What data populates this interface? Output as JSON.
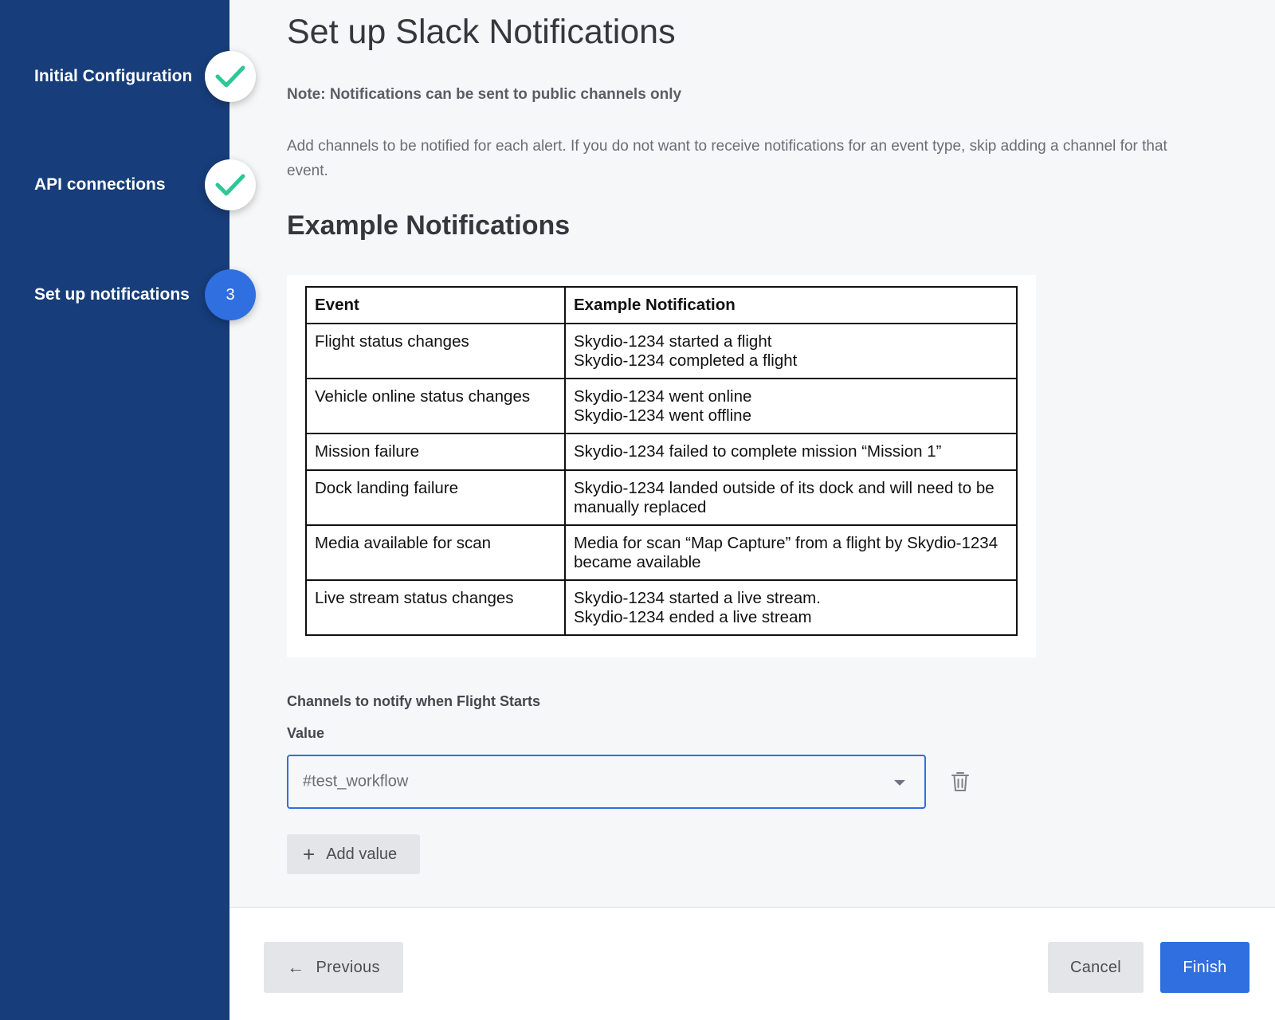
{
  "steps": [
    {
      "label": "Initial Configuration",
      "status": "done",
      "icon": "check-icon"
    },
    {
      "label": "API connections",
      "status": "done",
      "icon": "check-icon"
    },
    {
      "label": "Set up notifications",
      "status": "active",
      "number": "3"
    }
  ],
  "page": {
    "title": "Set up Slack Notifications",
    "note": "Note: Notifications can be sent to public channels only",
    "description": "Add channels to be notified for each alert. If you do not want to receive notifications for an event type, skip adding a channel for that event.",
    "section_title": "Example Notifications"
  },
  "examples_table": {
    "headers": [
      "Event",
      "Example Notification"
    ],
    "rows": [
      {
        "event": "Flight status changes",
        "lines": [
          "Skydio-1234 started a flight",
          "Skydio-1234 completed a flight"
        ]
      },
      {
        "event": "Vehicle online status changes",
        "lines": [
          "Skydio-1234 went online",
          "Skydio-1234 went offline"
        ]
      },
      {
        "event": "Mission failure",
        "lines": [
          "Skydio-1234 failed to complete mission “Mission 1”"
        ]
      },
      {
        "event": "Dock landing failure",
        "lines": [
          "Skydio-1234 landed outside of its dock and will need to be manually replaced"
        ]
      },
      {
        "event": "Media available for scan",
        "lines": [
          "Media for scan “Map Capture” from a flight by Skydio-1234 became available"
        ]
      },
      {
        "event": "Live stream status changes",
        "lines": [
          "Skydio-1234 started a live stream.",
          "Skydio-1234 ended a live stream"
        ]
      }
    ]
  },
  "channels": {
    "title": "Channels to notify when Flight Starts",
    "value_label": "Value",
    "selected": "#test_workflow",
    "add_label": "Add value"
  },
  "footer": {
    "previous_label": "Previous",
    "cancel_label": "Cancel",
    "finish_label": "Finish"
  },
  "colors": {
    "sidebar": "#173d7a",
    "accent": "#2f6fe0",
    "check": "#2ec796"
  }
}
